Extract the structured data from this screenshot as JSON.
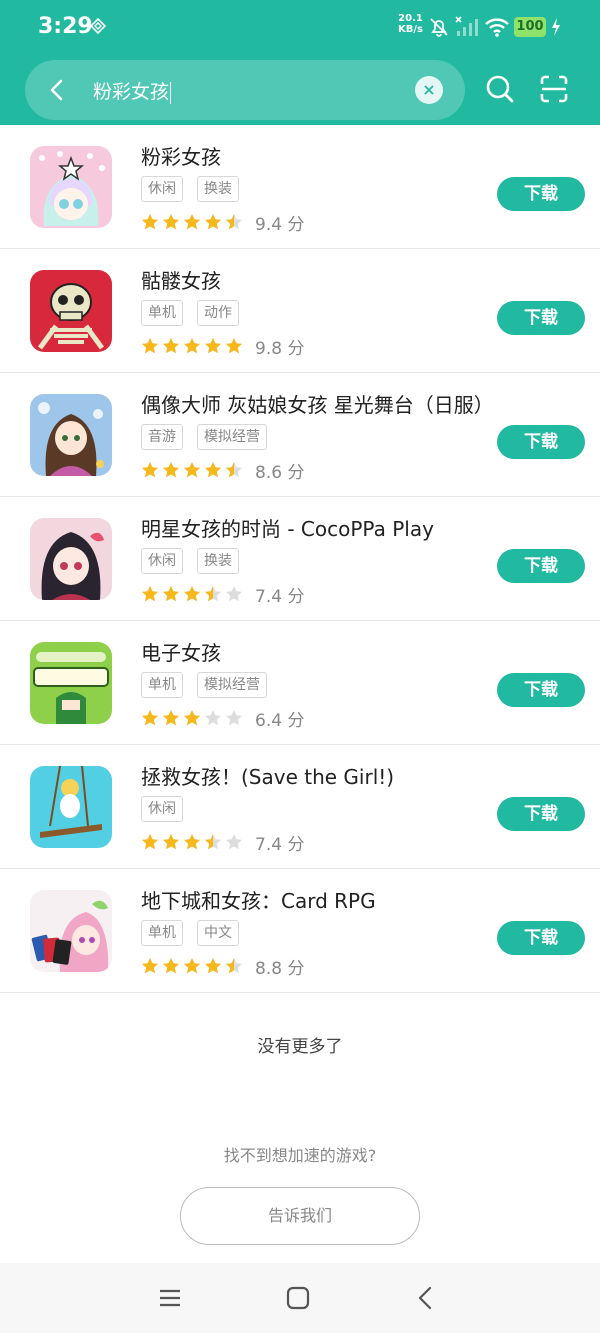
{
  "status_bar": {
    "time": "3:29",
    "net_speed_value": "20.1",
    "net_speed_unit": "KB/s",
    "battery": "100"
  },
  "search": {
    "query": "粉彩女孩"
  },
  "colors": {
    "accent": "#21b9a0",
    "star": "#f6b81a",
    "star_empty": "#dddddd"
  },
  "apps": [
    {
      "title": "粉彩女孩",
      "tags": [
        "休闲",
        "换装"
      ],
      "rating": 4.5,
      "score": "9.4 分",
      "button": "下载"
    },
    {
      "title": "骷髅女孩",
      "tags": [
        "单机",
        "动作"
      ],
      "rating": 5,
      "score": "9.8 分",
      "button": "下载"
    },
    {
      "title": "偶像大师 灰姑娘女孩 星光舞台（日服）",
      "tags": [
        "音游",
        "模拟经营"
      ],
      "rating": 4.5,
      "score": "8.6 分",
      "button": "下载"
    },
    {
      "title": "明星女孩的时尚 - CocoPPa Play",
      "tags": [
        "休闲",
        "换装"
      ],
      "rating": 3.5,
      "score": "7.4 分",
      "button": "下载"
    },
    {
      "title": "电子女孩",
      "tags": [
        "单机",
        "模拟经营"
      ],
      "rating": 3,
      "score": "6.4 分",
      "button": "下载"
    },
    {
      "title": "拯救女孩！(Save the Girl!)",
      "tags": [
        "休闲"
      ],
      "rating": 3.5,
      "score": "7.4 分",
      "button": "下载"
    },
    {
      "title": "地下城和女孩：Card RPG",
      "tags": [
        "单机",
        "中文"
      ],
      "rating": 4.5,
      "score": "8.8 分",
      "button": "下载"
    }
  ],
  "footer": {
    "no_more": "没有更多了",
    "cant_find": "找不到想加速的游戏?",
    "tell_us": "告诉我们"
  }
}
